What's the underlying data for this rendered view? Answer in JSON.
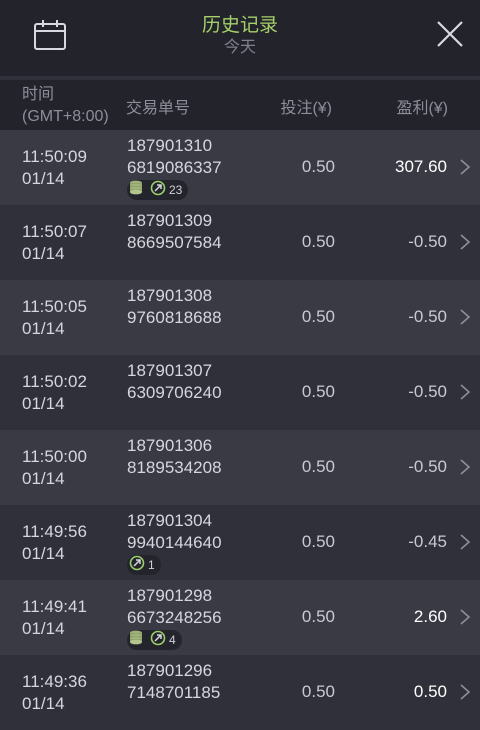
{
  "header": {
    "title": "历史记录",
    "subtitle": "今天",
    "icons": {
      "left": "calendar-icon",
      "right": "close-icon"
    },
    "colors": {
      "title": "#a6d06a",
      "background": "#22232b"
    }
  },
  "table": {
    "columns": {
      "time": "时间",
      "timezone": "(GMT+8:00)",
      "order": "交易单号",
      "stake": "投注(¥)",
      "profit": "盈利(¥)"
    },
    "rows": [
      {
        "time": "11:50:09",
        "date": "01/14",
        "order1": "187901310",
        "order2": "6819086337",
        "stake": "0.50",
        "profit": "307.60",
        "win": true,
        "coins": true,
        "share": "23"
      },
      {
        "time": "11:50:07",
        "date": "01/14",
        "order1": "187901309",
        "order2": "8669507584",
        "stake": "0.50",
        "profit": "-0.50",
        "win": false
      },
      {
        "time": "11:50:05",
        "date": "01/14",
        "order1": "187901308",
        "order2": "9760818688",
        "stake": "0.50",
        "profit": "-0.50",
        "win": false
      },
      {
        "time": "11:50:02",
        "date": "01/14",
        "order1": "187901307",
        "order2": "6309706240",
        "stake": "0.50",
        "profit": "-0.50",
        "win": false
      },
      {
        "time": "11:50:00",
        "date": "01/14",
        "order1": "187901306",
        "order2": "8189534208",
        "stake": "0.50",
        "profit": "-0.50",
        "win": false
      },
      {
        "time": "11:49:56",
        "date": "01/14",
        "order1": "187901304",
        "order2": "9940144640",
        "stake": "0.50",
        "profit": "-0.45",
        "win": false,
        "share": "1"
      },
      {
        "time": "11:49:41",
        "date": "01/14",
        "order1": "187901298",
        "order2": "6673248256",
        "stake": "0.50",
        "profit": "2.60",
        "win": true,
        "coins": true,
        "share": "4"
      },
      {
        "time": "11:49:36",
        "date": "01/14",
        "order1": "187901296",
        "order2": "7148701185",
        "stake": "0.50",
        "profit": "0.50",
        "win": true
      }
    ]
  }
}
